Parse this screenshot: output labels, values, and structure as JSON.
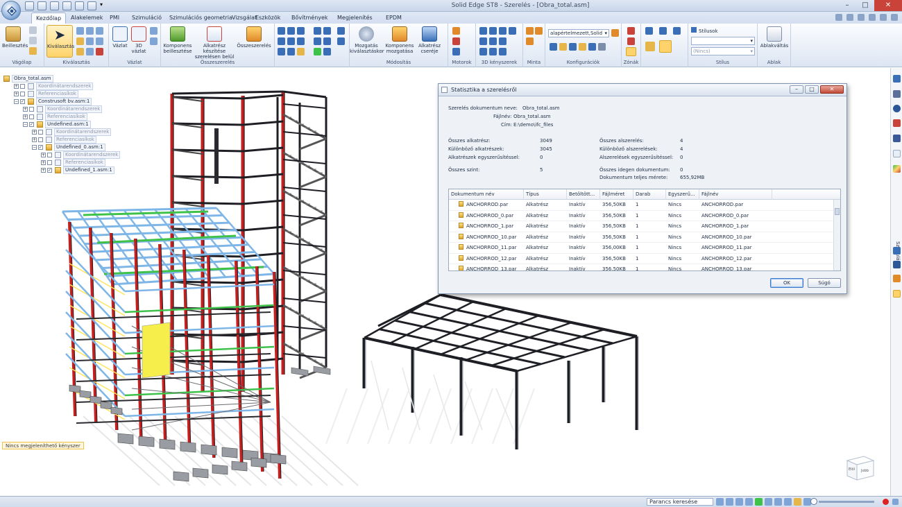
{
  "window": {
    "title": "Solid Edge ST8 - Szerelés - [Obra_total.asm]",
    "minimize": "–",
    "maximize": "□",
    "close": "✕"
  },
  "tabs": [
    {
      "label": "Kezdőlap",
      "active": true
    },
    {
      "label": "Alakelemek"
    },
    {
      "label": "PMI"
    },
    {
      "label": "Szimuláció"
    },
    {
      "label": "Szimulációs geometria"
    },
    {
      "label": "Vizsgálat"
    },
    {
      "label": "Eszközök"
    },
    {
      "label": "Bővítmények"
    },
    {
      "label": "Megjelenítés"
    },
    {
      "label": "EPDM"
    }
  ],
  "ribbon": {
    "vagolap": {
      "label": "Vágólap",
      "paste": "Beillesztés"
    },
    "kivalasztas": {
      "label": "Kiválasztás",
      "select": "Kiválasztás"
    },
    "vazlat": {
      "label": "Vázlat",
      "sketch": "Vázlat",
      "sketch3d": "3D vázlat"
    },
    "osszeszereles": {
      "label": "Összeszerelés",
      "insert": "Komponens beillesztése",
      "create": "Alkatrész készítése szerelésen belül",
      "assemble": "Összeszerelés"
    },
    "modositas": {
      "label": "Módosítás",
      "move_sel": "Mozgatás kiválasztáskor",
      "move_comp": "Komponens mozgatása",
      "replace": "Alkatrész cseréje"
    },
    "motorok": {
      "label": "Motorok"
    },
    "kerszer": {
      "label": "3D kényszerek"
    },
    "minta": {
      "label": "Minta"
    },
    "konfig": {
      "label": "Konfigurációk",
      "value": "alapértelmezett,Solid"
    },
    "zonak": {
      "label": "Zónák"
    },
    "stilus": {
      "label": "Stílus",
      "styles": "Stílusok",
      "none": "(Nincs)"
    },
    "ablak": {
      "label": "Ablak",
      "switch": "Ablakváltás"
    }
  },
  "tree": [
    {
      "label": "Obra_total.asm",
      "level": 0,
      "exp": "",
      "cb": "",
      "icon": "asm",
      "dim": false
    },
    {
      "label": "Koordinátarendszerek",
      "level": 1,
      "exp": "+",
      "cb": " ",
      "icon": "ref",
      "dim": true
    },
    {
      "label": "Referenciasíkok",
      "level": 1,
      "exp": "+",
      "cb": " ",
      "icon": "ref",
      "dim": true
    },
    {
      "label": "Construsoft bv.asm:1",
      "level": 1,
      "exp": "−",
      "cb": "✓",
      "icon": "asm",
      "dim": false
    },
    {
      "label": "Koordinátarendszerek",
      "level": 2,
      "exp": "+",
      "cb": " ",
      "icon": "ref",
      "dim": true
    },
    {
      "label": "Referenciasíkok",
      "level": 2,
      "exp": "+",
      "cb": " ",
      "icon": "ref",
      "dim": true
    },
    {
      "label": "Undefined.asm:1",
      "level": 2,
      "exp": "−",
      "cb": "✓",
      "icon": "asm",
      "dim": false
    },
    {
      "label": "Koordinátarendszerek",
      "level": 3,
      "exp": "+",
      "cb": " ",
      "icon": "ref",
      "dim": true
    },
    {
      "label": "Referenciasíkok",
      "level": 3,
      "exp": "+",
      "cb": " ",
      "icon": "ref",
      "dim": true
    },
    {
      "label": "Undefined_0.asm:1",
      "level": 3,
      "exp": "−",
      "cb": "✓",
      "icon": "asm",
      "dim": false
    },
    {
      "label": "Koordinátarendszerek",
      "level": 4,
      "exp": "+",
      "cb": " ",
      "icon": "ref",
      "dim": true
    },
    {
      "label": "Referenciasíkok",
      "level": 4,
      "exp": "+",
      "cb": " ",
      "icon": "ref",
      "dim": true
    },
    {
      "label": "Undefined_1.asm:1",
      "level": 4,
      "exp": "+",
      "cb": "✓",
      "icon": "asm",
      "dim": false
    }
  ],
  "prompt": "Nincs megjeleníthető kényszer",
  "dialog": {
    "title": "Statisztika a szerelésről",
    "doc_name_label": "Szerelés dokumentum neve:",
    "doc_name": "Obra_total.asm",
    "file_label": "Fájlnév:",
    "file": "Obra_total.asm",
    "addr_label": "Cím:",
    "addr": "E:\\demo\\ifc_files",
    "stats_left": [
      {
        "label": "Összes alkatrész:",
        "value": "3049"
      },
      {
        "label": "Különböző alkatrészek:",
        "value": "3045"
      },
      {
        "label": "Alkatrészek egyszerűsítéssel:",
        "value": "0"
      },
      {
        "label": "Összes szint:",
        "value": "5"
      }
    ],
    "stats_right": [
      {
        "label": "Összes alszerelés:",
        "value": "4"
      },
      {
        "label": "Különböző alszerelések:",
        "value": "4"
      },
      {
        "label": "Alszerelések egyszerűsítéssel:",
        "value": "0"
      },
      {
        "label": "Összes idegen dokumentum:",
        "value": "0"
      },
      {
        "label": "Dokumentum teljes mérete:",
        "value": "655,92MB"
      }
    ],
    "columns": [
      "Dokumentum név",
      "Típus",
      "Betöltött...",
      "Fájlméret",
      "Darab",
      "Egyszerű...",
      "Fájlnév"
    ],
    "rows": [
      [
        "ANCHORROD.par",
        "Alkatrész",
        "Inaktív",
        "356,50KB",
        "1",
        "Nincs",
        "ANCHORROD.par"
      ],
      [
        "ANCHORROD_0.par",
        "Alkatrész",
        "Inaktív",
        "356,50KB",
        "1",
        "Nincs",
        "ANCHORROD_0.par"
      ],
      [
        "ANCHORROD_1.par",
        "Alkatrész",
        "Inaktív",
        "356,50KB",
        "1",
        "Nincs",
        "ANCHORROD_1.par"
      ],
      [
        "ANCHORROD_10.par",
        "Alkatrész",
        "Inaktív",
        "356,50KB",
        "1",
        "Nincs",
        "ANCHORROD_10.par"
      ],
      [
        "ANCHORROD_11.par",
        "Alkatrész",
        "Inaktív",
        "356,00KB",
        "1",
        "Nincs",
        "ANCHORROD_11.par"
      ],
      [
        "ANCHORROD_12.par",
        "Alkatrész",
        "Inaktív",
        "356,50KB",
        "1",
        "Nincs",
        "ANCHORROD_12.par"
      ],
      [
        "ANCHORROD_13.par",
        "Alkatrész",
        "Inaktív",
        "356,50KB",
        "1",
        "Nincs",
        "ANCHORROD_13.par"
      ]
    ],
    "ok": "OK",
    "help": "Súgó"
  },
  "right_panel": {
    "label": "Szimuláció"
  },
  "viewcube": {
    "front": "Elöl",
    "right": "Jobb"
  },
  "status": {
    "command_search": "Parancs keresése"
  },
  "colors": {
    "accent": "#2b5797",
    "beam_red": "#c81e1e",
    "beam_blue": "#7fb6e8",
    "beam_green": "#3fc24a",
    "dark_steel": "#1e1f24"
  }
}
